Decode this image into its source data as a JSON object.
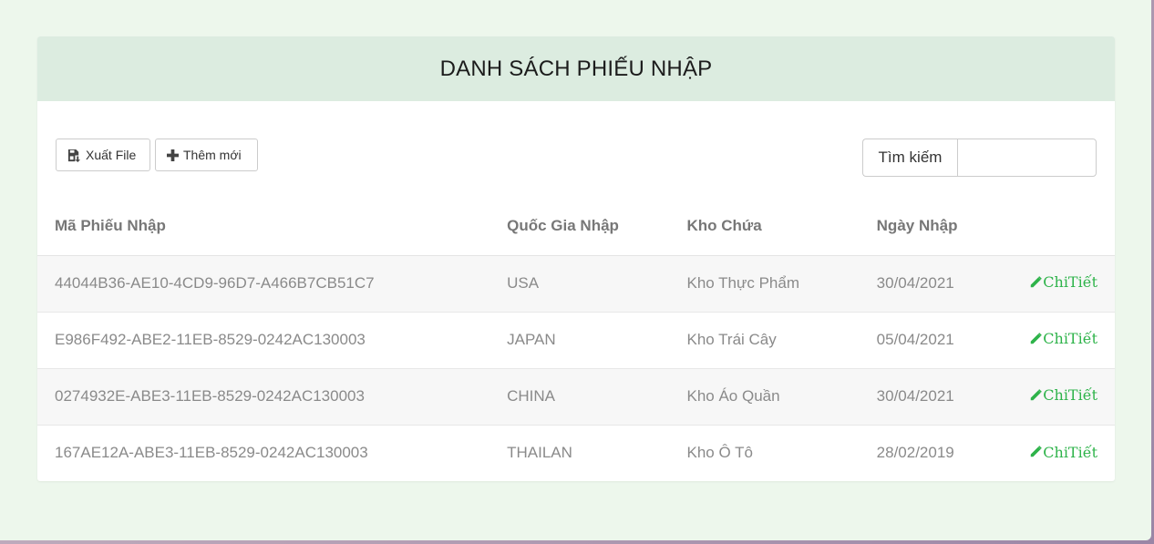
{
  "page": {
    "title": "DANH SÁCH PHIẾU NHẬP"
  },
  "toolbar": {
    "export_label": "Xuất File",
    "export_icon": "save-export-icon",
    "add_label": "Thêm mới",
    "add_icon": "plus-icon",
    "search_label": "Tìm kiếm",
    "search_value": ""
  },
  "table": {
    "headers": [
      "Mã Phiếu Nhập",
      "Quốc Gia Nhập",
      "Kho Chứa",
      "Ngày Nhập"
    ],
    "action_label": "ChiTiết",
    "action_icon": "pencil-icon",
    "rows": [
      {
        "id": "44044B36-AE10-4CD9-96D7-A466B7CB51C7",
        "country": "USA",
        "warehouse": "Kho Thực Phẩm",
        "date": "30/04/2021"
      },
      {
        "id": "E986F492-ABE2-11EB-8529-0242AC130003",
        "country": "JAPAN",
        "warehouse": "Kho Trái Cây",
        "date": "05/04/2021"
      },
      {
        "id": "0274932E-ABE3-11EB-8529-0242AC130003",
        "country": "CHINA",
        "warehouse": "Kho Áo Quần",
        "date": "30/04/2021"
      },
      {
        "id": "167AE12A-ABE3-11EB-8529-0242AC130003",
        "country": "THAILAN",
        "warehouse": "Kho Ô Tô",
        "date": "28/02/2019"
      }
    ]
  },
  "colors": {
    "page_background": "#edf7ec",
    "header_background": "#dcece0",
    "link": "#2eb34a",
    "row_stripe": "#f7f7f7"
  }
}
